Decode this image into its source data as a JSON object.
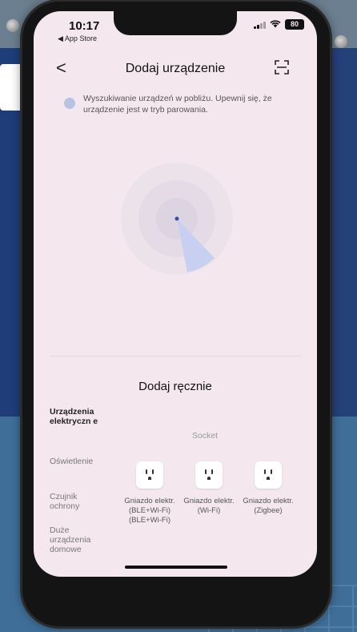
{
  "status_bar": {
    "time": "10:17",
    "back_app": "◀ App Store",
    "battery": "80"
  },
  "nav": {
    "title": "Dodaj urządzenie",
    "back_symbol": "<"
  },
  "search": {
    "hint": "Wyszukiwanie urządzeń w pobliżu. Upewnij się, że urządzenie jest w tryb parowania."
  },
  "manual": {
    "title": "Dodaj ręcznie",
    "categories": [
      {
        "label": "Urządzenia elektryczn e",
        "active": true
      },
      {
        "label": "Oświetlenie"
      },
      {
        "label": "Czujnik ochrony"
      },
      {
        "label": "Duże urządzenia domowe"
      }
    ],
    "section": "Socket",
    "devices": [
      {
        "label": "Gniazdo elektr. (BLE+Wi-Fi) (BLE+Wi-Fi)",
        "icon": "socket-icon"
      },
      {
        "label": "Gniazdo elektr. (Wi-Fi)",
        "icon": "socket-icon"
      },
      {
        "label": "Gniazdo elektr. (Zigbee)",
        "icon": "socket-icon"
      }
    ]
  },
  "icons": {
    "wifi": "wifi-icon",
    "scan": "scan-icon",
    "back": "chevron-left-icon"
  },
  "colors": {
    "accent": "#c7d0f0",
    "screen_bg": "#f4e8ee"
  }
}
